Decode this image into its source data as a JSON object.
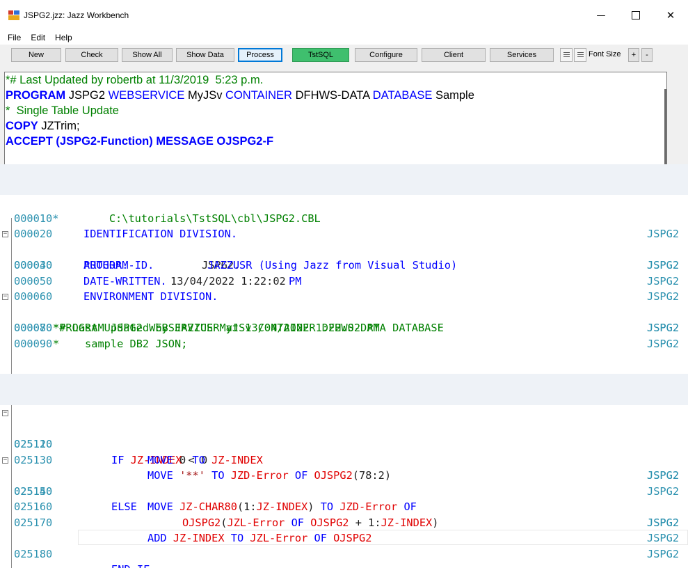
{
  "window": {
    "title": "JSPG2.jzz: Jazz Workbench",
    "minimize_glyph": "—",
    "close_glyph": "✕"
  },
  "menu": [
    "File",
    "Edit",
    "Help"
  ],
  "toolbar": {
    "buttons": [
      "New",
      "Check",
      "Show All",
      "Show Data",
      "Process",
      "TstSQL",
      "Configure",
      "Client",
      "Services"
    ],
    "font_size_label": "Font Size",
    "plus": "+",
    "minus": "-"
  },
  "editor": {
    "l1": "*# Last Updated by robertb at 11/3/2019  5:23 p.m.",
    "l2_kw1": "PROGRAM",
    "l2_t1": " JSPG2 ",
    "l2_kw2": "WEBSERVICE",
    "l2_t2": " MyJSv ",
    "l2_kw3": "CONTAINER",
    "l2_t3": " DFHWS-DATA ",
    "l2_kw4": "DATABASE",
    "l2_t4": " Sample",
    "l3": "*  Single Table Update",
    "l4_kw": "COPY",
    "l4_t": " JZTrim;",
    "l5": "ACCEPT (JSPG2-Function) MESSAGE OJSPG2-F"
  },
  "pane1": {
    "lines": [
      {
        "seq": "000010*",
        "code": "    C:\\tutorials\\TstSQL\\cbl\\JSPG2.CBL",
        "id": ""
      },
      {
        "seq": "000020",
        "code": "IDENTIFICATION DIVISION.",
        "id": "JSPG2"
      },
      {
        "seq": "000030",
        "code": "PROGRAM-ID.",
        "code_b": "JSPG2.",
        "id": "JSPG2"
      },
      {
        "seq": "000040",
        "code": "AUTHOR.",
        "code_b": "JAZZUSR (Using Jazz from Visual Studio)",
        "id": "JSPG2"
      },
      {
        "seq": "000050",
        "code": "DATE-WRITTEN.",
        "code_b": "13/04/2022 1:22:02",
        "code_c": "PM",
        "id": "JSPG2"
      },
      {
        "seq": "000060",
        "code": "ENVIRONMENT DIVISION.",
        "id": "JSPG2"
      },
      {
        "seq": "000070",
        "code": "*# Last Updated by JAZZUSR at 13/04/2022 1:22:02 PM",
        "id": "JSPG2"
      },
      {
        "seq": "000080",
        "code": "*PROGRAM JSPG2 WEBSERVICE MyJSv CONTAINER DFHWS-DATA DATABASE",
        "id": "JSPG2"
      },
      {
        "seq": "000090",
        "code": "*    sample DB2 JSON;",
        "id": "JSPG2"
      }
    ]
  },
  "pane2": {
    "lines": [
      {
        "seq": "025110",
        "id": "JSPG2"
      },
      {
        "seq": "025120",
        "id": "JSPG2"
      },
      {
        "seq": "025130",
        "id": "JSPG2"
      },
      {
        "seq": "025140",
        "id": "JSPG2"
      },
      {
        "seq": "025150",
        "id": "JSPG2"
      },
      {
        "seq": "025160",
        "id": "JSPG2"
      },
      {
        "seq": "025170",
        "id": "JSPG2"
      },
      {
        "seq": "025180",
        "id": "JSPG2"
      }
    ],
    "t": {
      "if": "IF",
      "jzindex": "JZ-INDEX",
      "lt0": " < 0",
      "move": "MOVE",
      "zero": " 0 ",
      "to": "TO",
      "str": "'**'",
      "jzderror": "JZD-Error",
      "of": "OF",
      "ojspg2": "OJSPG2",
      "r78": "(78:2)",
      "else": "ELSE",
      "jzchar": "JZ-CHAR80",
      "p1": "(1:",
      "p2": ")",
      "ojspg2b": "OJSPG2",
      "jzlerror": "JZL-Error",
      "plus1": " + 1:",
      "add": "ADD",
      "endif": "END-IF."
    }
  },
  "colors": {
    "keyword": "#0000ff",
    "comment": "#008000",
    "identifier": "#e00000",
    "sequence": "#2b91af",
    "tstsql_button": "#3fbf6e"
  }
}
